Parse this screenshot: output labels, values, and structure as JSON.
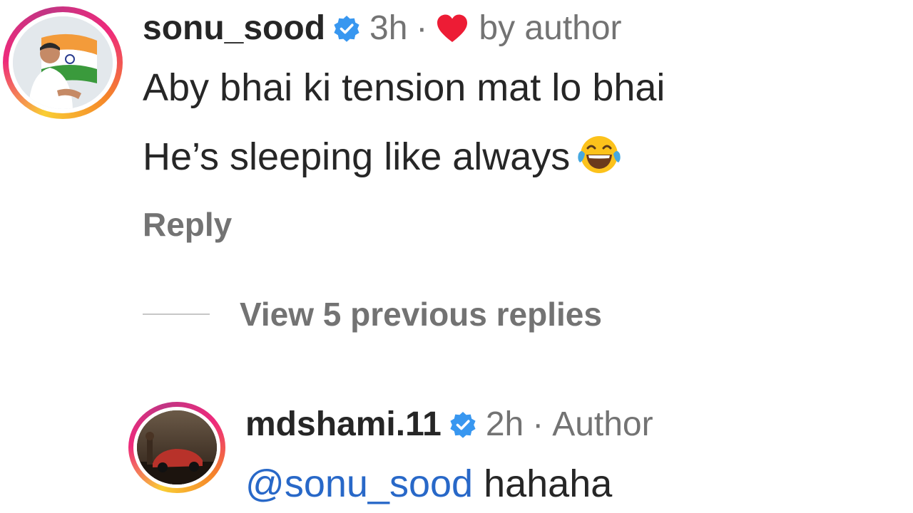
{
  "comment1": {
    "username": "sonu_sood",
    "time": "3h",
    "liked_by_label": "by author",
    "line1": "Aby bhai ki tension mat lo bhai",
    "line2": "He’s sleeping like always",
    "emoji": "face-with-tears-of-joy",
    "reply_label": "Reply"
  },
  "thread": {
    "view_replies_label": "View 5 previous replies"
  },
  "comment2": {
    "username": "mdshami.11",
    "time": "2h",
    "badge_label": "Author",
    "mention": "@sonu_sood",
    "text": "hahaha"
  },
  "colors": {
    "verified_blue": "#3897f0",
    "heart_red": "#ed1c35",
    "mention_blue": "#2868c8",
    "secondary_text": "#737373",
    "primary_text": "#262626"
  },
  "icons": {
    "verified": "verified-badge-icon",
    "heart": "heart-icon",
    "emoji": "laughing-tears-emoji"
  }
}
